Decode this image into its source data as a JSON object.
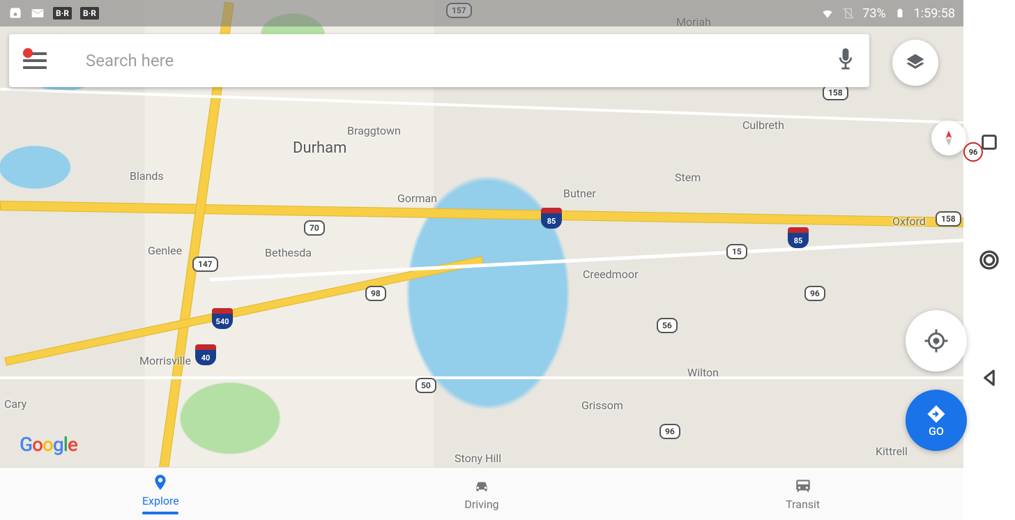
{
  "status": {
    "battery": "73%",
    "time": "1:59:58",
    "br1": "B·R",
    "br2": "B·R"
  },
  "search": {
    "placeholder": "Search here"
  },
  "fab": {
    "go_label": "GO",
    "speed_limit": "96"
  },
  "nav": {
    "explore": "Explore",
    "driving": "Driving",
    "transit": "Transit"
  },
  "logo": {
    "g": "G",
    "o1": "o",
    "o2": "o",
    "g2": "g",
    "l": "l",
    "e": "e"
  },
  "map": {
    "cities": {
      "durham": "Durham",
      "braggtown": "Braggtown",
      "moriah": "Moriah",
      "culbreth": "Culbreth",
      "stem": "Stem",
      "butner": "Butner",
      "gorman": "Gorman",
      "blands": "Blands",
      "genlee": "Genlee",
      "bethesda": "Bethesda",
      "creedmoor": "Creedmoor",
      "oxford": "Oxford",
      "morrisville": "Morrisville",
      "wilton": "Wilton",
      "grissom": "Grissom",
      "cary": "Cary",
      "stony_hill": "Stony Hill",
      "kittrell": "Kittrell"
    },
    "routes": {
      "r157": "157",
      "r158a": "158",
      "r158b": "158",
      "r70": "70",
      "r147": "147",
      "r98": "98",
      "r15": "15",
      "r50": "50",
      "r56": "56",
      "r96a": "96",
      "r96b": "96",
      "i85a": "85",
      "i85b": "85",
      "i540": "540",
      "i40": "40"
    }
  }
}
